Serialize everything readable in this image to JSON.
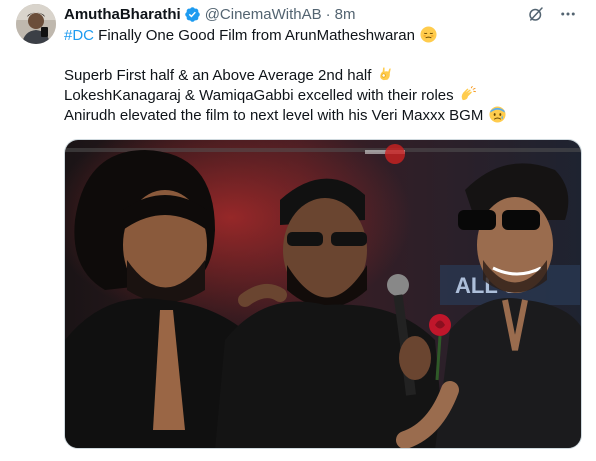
{
  "author": {
    "name": "AmuthaBharathi",
    "handle": "@CinemaWithAB",
    "separator": "·",
    "time": "8m",
    "verified": true,
    "verified_color": "#1d9bf0"
  },
  "actions": {
    "grok_icon": "slash-circle-icon",
    "more_icon": "more-dots-icon"
  },
  "tweet": {
    "hashtag": "#DC",
    "line1_text": " Finally One Good Film from ArunMatheshwaran",
    "line1_emoji": "relieved-face-emoji",
    "line2_text": "Superb First half & an Above Average 2nd half",
    "line2_emoji": "ok-hand-emoji",
    "line3_text": "LokeshKanagaraj & WamiqaGabbi excelled with their roles",
    "line3_emoji": "clapping-hands-emoji",
    "line4_text": "Anirudh elevated the film to next level with his Veri Maxxx BGM",
    "line4_emoji": "anxious-face-emoji"
  },
  "media": {
    "type": "photo",
    "backdrop_text": "ALL S"
  },
  "colors": {
    "text": "#0f1419",
    "secondary": "#536471",
    "link": "#1d9bf0"
  }
}
